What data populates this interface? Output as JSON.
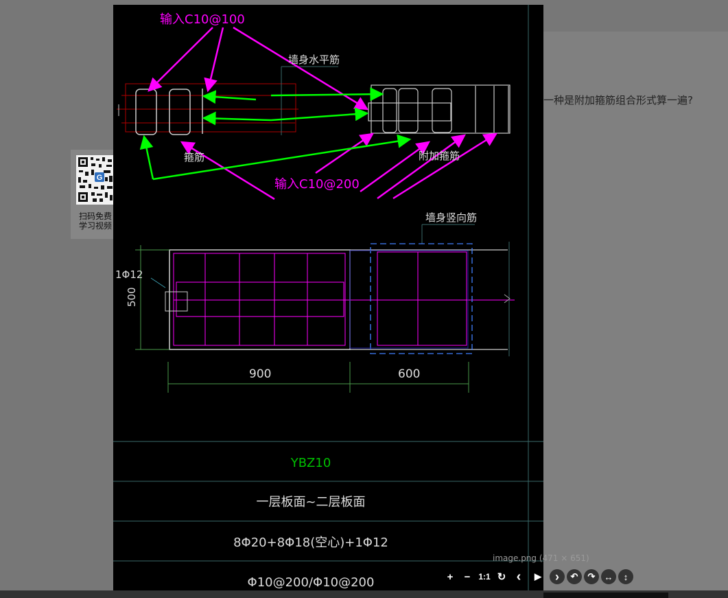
{
  "page": {
    "question_text": "一种是附加箍筋组合形式算一遍?",
    "qr_caption_line1": "扫码免费",
    "qr_caption_line2": "学习视频",
    "qr_logo": "G"
  },
  "image": {
    "annot_top": "输入C10@100",
    "annot_bottom": "输入C10@200",
    "label_wall_horizontal": "墙身水平筋",
    "label_hoop": "箍筋",
    "label_extra_hoop": "附加箍筋",
    "label_wall_vertical": "墙身竖向筋",
    "label_edge_bar": "1Φ12",
    "dim_height": "500",
    "dim_width1": "900",
    "dim_width2": "600",
    "table_name": "YBZ10",
    "table_level": "一层板面~二层板面",
    "table_rebar": "8Φ20+8Φ18(空心)+1Φ12",
    "table_stirrup": "Φ10@200/Φ10@200"
  },
  "viewer": {
    "caption": "image.png (471 × 651)",
    "toolbar": [
      {
        "name": "zoom-in-icon",
        "glyph": "+"
      },
      {
        "name": "zoom-out-icon",
        "glyph": "−"
      },
      {
        "name": "actual-size-icon",
        "glyph": "1:1"
      },
      {
        "name": "reset-icon",
        "glyph": "↻"
      },
      {
        "name": "prev-icon",
        "glyph": "‹"
      },
      {
        "name": "play-icon",
        "glyph": "▶"
      },
      {
        "name": "next-icon",
        "glyph": "›"
      },
      {
        "name": "rotate-left-icon",
        "glyph": "↶"
      },
      {
        "name": "rotate-right-icon",
        "glyph": "↷"
      },
      {
        "name": "flip-horizontal-icon",
        "glyph": "↔"
      },
      {
        "name": "flip-vertical-icon",
        "glyph": "↕"
      }
    ]
  }
}
